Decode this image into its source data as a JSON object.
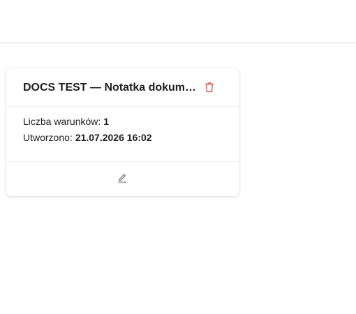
{
  "card": {
    "title": "DOCS TEST — Notatka dokumentacyjna",
    "conditions_label": "Liczba warunków:",
    "conditions_value": "1",
    "created_label": "Utworzono:",
    "created_value": "21.07.2026 16:02",
    "delete_icon": "trash-icon",
    "edit_icon": "pencil-icon"
  },
  "colors": {
    "delete": "#e0473d",
    "edit": "#666666",
    "divider": "#d9d9d9"
  }
}
